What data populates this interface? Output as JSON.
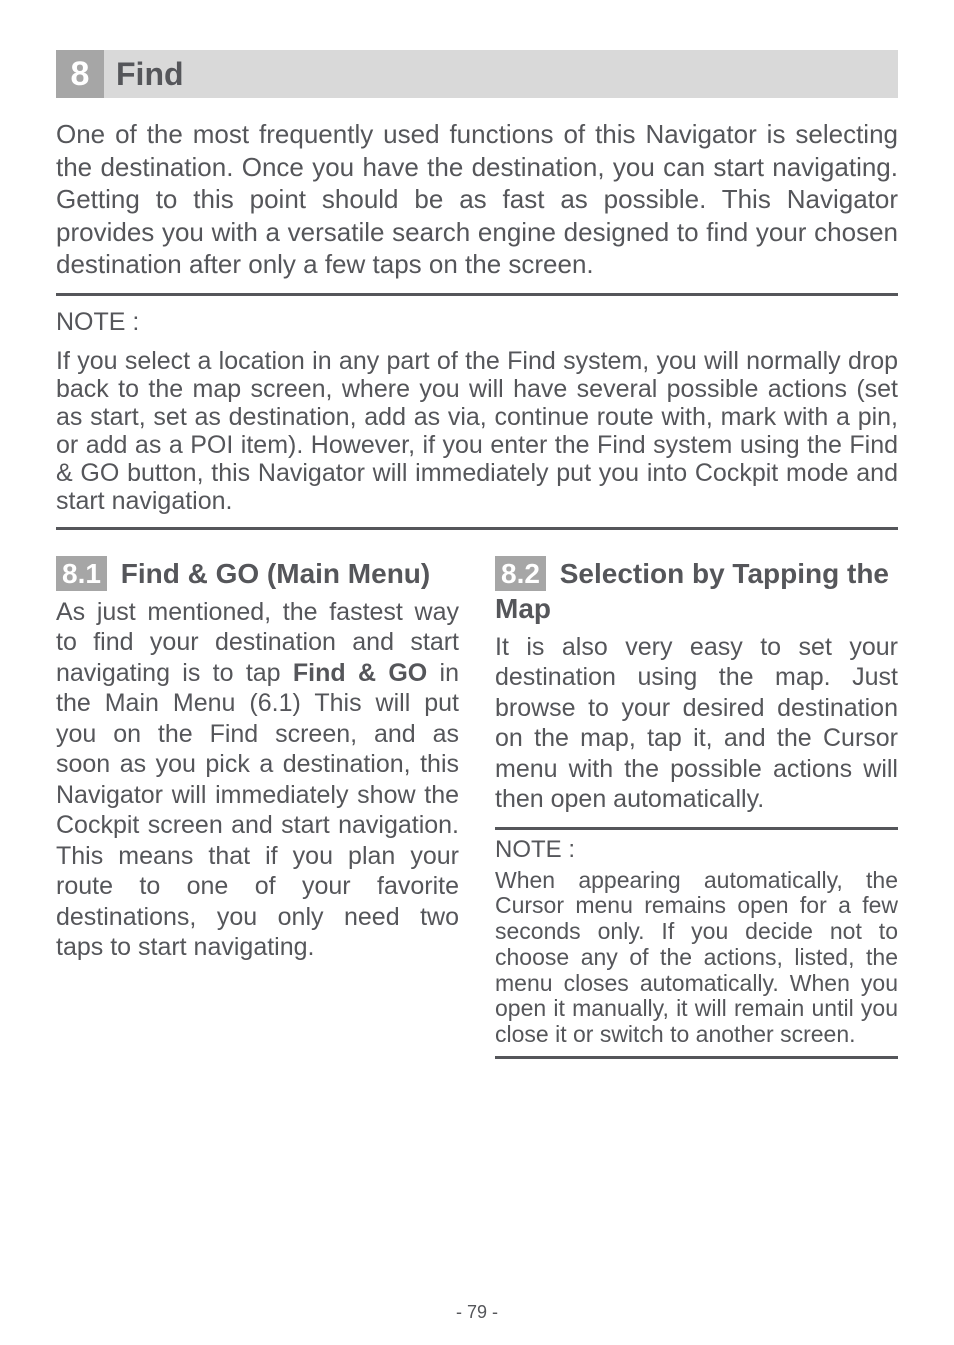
{
  "chapter": {
    "number": "8",
    "title": "Find"
  },
  "intro": "One of the most frequently used functions of this Navigator is selecting the destination. Once you have the destination, you can start navigating. Getting to this point should be as fast as possible. This Navigator provides you with a versatile search engine designed to find your chosen destination after only a few taps on the screen.",
  "note": {
    "label": "NOTE :",
    "body": "If you select a location in any part of the Find system, you will normally drop back to the map screen, where you will have several possible actions (set as start, set as destination, add as via, continue route with, mark with a pin, or add as a POI item). However, if you enter the Find system using the Find & GO button, this Navigator will immediately put you into Cockpit mode and start navigation."
  },
  "section81": {
    "number": "8.1",
    "title_rest": " Find & GO (Main Menu)",
    "para_pre": "As just mentioned, the fastest way to find your destination and start navigating is to tap ",
    "bold": "Find & GO",
    "para_post": " in the Main Menu (6.1) This will put you on the Find screen, and as soon as you pick a destination, this Navigator will immediately show the Cockpit screen and start navigation. This means that if you plan your route to one of your favorite destinations, you only need two taps to start navigating."
  },
  "section82": {
    "number": "8.2",
    "title_rest": "  Selection by Tapping the Map",
    "para": "It is also very easy to set your destination using the map. Just browse to your desired destination on the map, tap it, and the Cursor menu with the possible actions will then open automatically."
  },
  "col_note": {
    "label": "NOTE :",
    "body": "When appearing automatically, the Cursor menu remains open for a few seconds only. If you decide not to choose any of the actions, listed, the menu closes automatically. When you open it manually, it will remain until you close it or switch to another screen."
  },
  "page_number": "- 79 -"
}
